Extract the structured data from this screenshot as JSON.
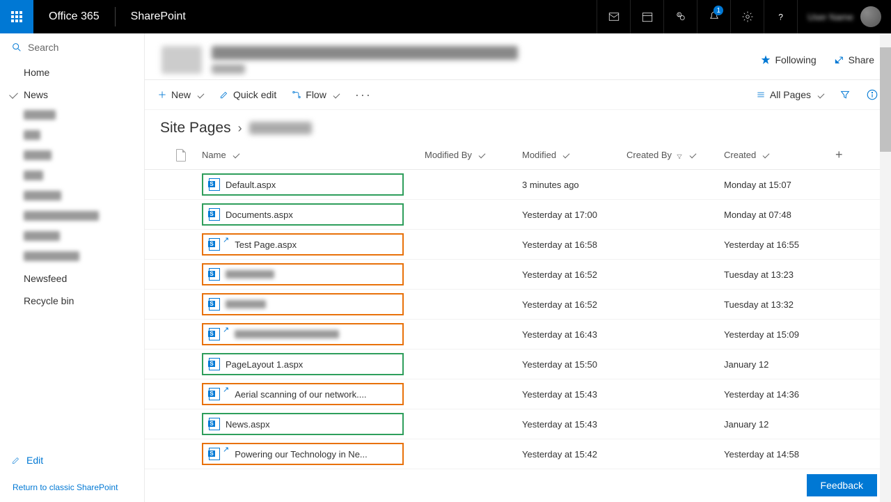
{
  "suite": {
    "o365": "Office 365",
    "app": "SharePoint",
    "notification_count": "1"
  },
  "search": {
    "placeholder": "Search"
  },
  "nav": {
    "home": "Home",
    "news": "News",
    "newsfeed": "Newsfeed",
    "recycle": "Recycle bin",
    "edit": "Edit",
    "classic": "Return to classic SharePoint"
  },
  "actions": {
    "following": "Following",
    "share": "Share"
  },
  "cmd": {
    "new": "New",
    "quick_edit": "Quick edit",
    "flow": "Flow",
    "all_pages": "All Pages"
  },
  "breadcrumb": {
    "root": "Site Pages"
  },
  "cols": {
    "name": "Name",
    "modified_by": "Modified By",
    "modified": "Modified",
    "created_by": "Created By",
    "created": "Created"
  },
  "rows": [
    {
      "name": "Default.aspx",
      "blurName": false,
      "share": false,
      "color": "green",
      "modified": "3 minutes ago",
      "created": "Monday at 15:07"
    },
    {
      "name": "Documents.aspx",
      "blurName": false,
      "share": false,
      "color": "green",
      "modified": "Yesterday at 17:00",
      "created": "Monday at 07:48"
    },
    {
      "name": "Test Page.aspx",
      "blurName": false,
      "share": true,
      "color": "orange",
      "modified": "Yesterday at 16:58",
      "created": "Yesterday at 16:55"
    },
    {
      "name": "",
      "blurName": true,
      "share": false,
      "color": "orange",
      "modified": "Yesterday at 16:52",
      "created": "Tuesday at 13:23",
      "nameBlurW": 70
    },
    {
      "name": "",
      "blurName": true,
      "share": false,
      "color": "orange",
      "modified": "Yesterday at 16:52",
      "created": "Tuesday at 13:32",
      "nameBlurW": 58
    },
    {
      "name": "",
      "blurName": true,
      "share": true,
      "color": "orange",
      "modified": "Yesterday at 16:43",
      "created": "Yesterday at 15:09",
      "nameBlurW": 150
    },
    {
      "name": "PageLayout 1.aspx",
      "blurName": false,
      "share": false,
      "color": "green",
      "modified": "Yesterday at 15:50",
      "created": "January 12"
    },
    {
      "name": "Aerial scanning of our network....",
      "blurName": false,
      "share": true,
      "color": "orange",
      "modified": "Yesterday at 15:43",
      "created": "Yesterday at 14:36"
    },
    {
      "name": "News.aspx",
      "blurName": false,
      "share": false,
      "color": "green",
      "modified": "Yesterday at 15:43",
      "created": "January 12"
    },
    {
      "name": "Powering our Technology in Ne...",
      "blurName": false,
      "share": true,
      "color": "orange",
      "modified": "Yesterday at 15:42",
      "created": "Yesterday at 14:58"
    }
  ],
  "nav_blurs": [
    46,
    24,
    40,
    28,
    54,
    108,
    52,
    80
  ],
  "feedback": "Feedback"
}
